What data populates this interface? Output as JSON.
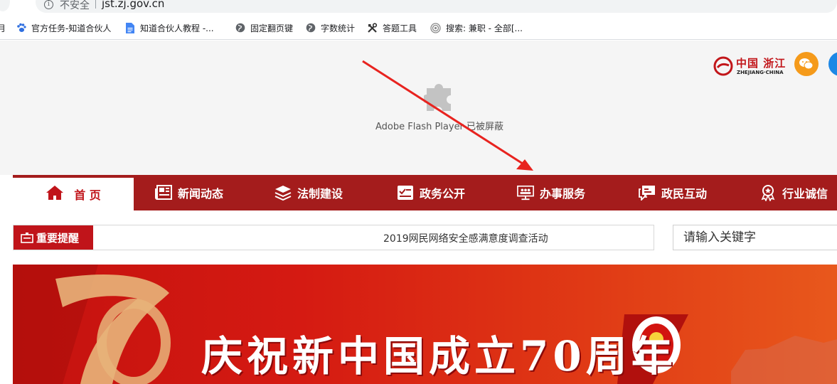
{
  "browser": {
    "security_label": "不安全",
    "url": "jst.zj.gov.cn",
    "info_icon": "info-icon"
  },
  "bookmarks": [
    {
      "label": "官方任务-知道合伙人",
      "icon": "baidu-paw-icon",
      "color": "#2f6fe0"
    },
    {
      "label": "知道合伙人教程 -...",
      "icon": "doc-icon",
      "color": "#4285f4"
    },
    {
      "label": "固定翻页键",
      "icon": "globe-icon",
      "color": "#5f6368"
    },
    {
      "label": "字数统计",
      "icon": "globe-icon",
      "color": "#5f6368"
    },
    {
      "label": "答题工具",
      "icon": "tools-icon",
      "color": "#333333"
    },
    {
      "label": "搜索: 兼职 - 全部[...",
      "icon": "target-icon",
      "color": "#888888"
    }
  ],
  "flash": {
    "message": "Adobe Flash Player 已被屏蔽",
    "icon": "puzzle-icon"
  },
  "logo": {
    "title": "中国 浙江",
    "subtitle": "ZHEJIANG·CHINA"
  },
  "nav": {
    "home": "首 页",
    "items": [
      {
        "label": "新闻动态",
        "icon": "newspaper-icon"
      },
      {
        "label": "法制建设",
        "icon": "layers-icon"
      },
      {
        "label": "政务公开",
        "icon": "checkbox-list-icon"
      },
      {
        "label": "办事服务",
        "icon": "people-screen-icon"
      },
      {
        "label": "政民互动",
        "icon": "chat-icon"
      },
      {
        "label": "行业诚信",
        "icon": "award-icon"
      }
    ]
  },
  "notice": {
    "tag": "重要提醒",
    "text": "2019网民网络安全感满意度调查活动"
  },
  "search": {
    "placeholder": "请输入关键字"
  },
  "banner": {
    "title": "庆祝新中国成立70周年"
  },
  "colors": {
    "nav_red": "#a41c1c",
    "accent_red": "#c0141a",
    "annotation_arrow": "#e8231f"
  }
}
